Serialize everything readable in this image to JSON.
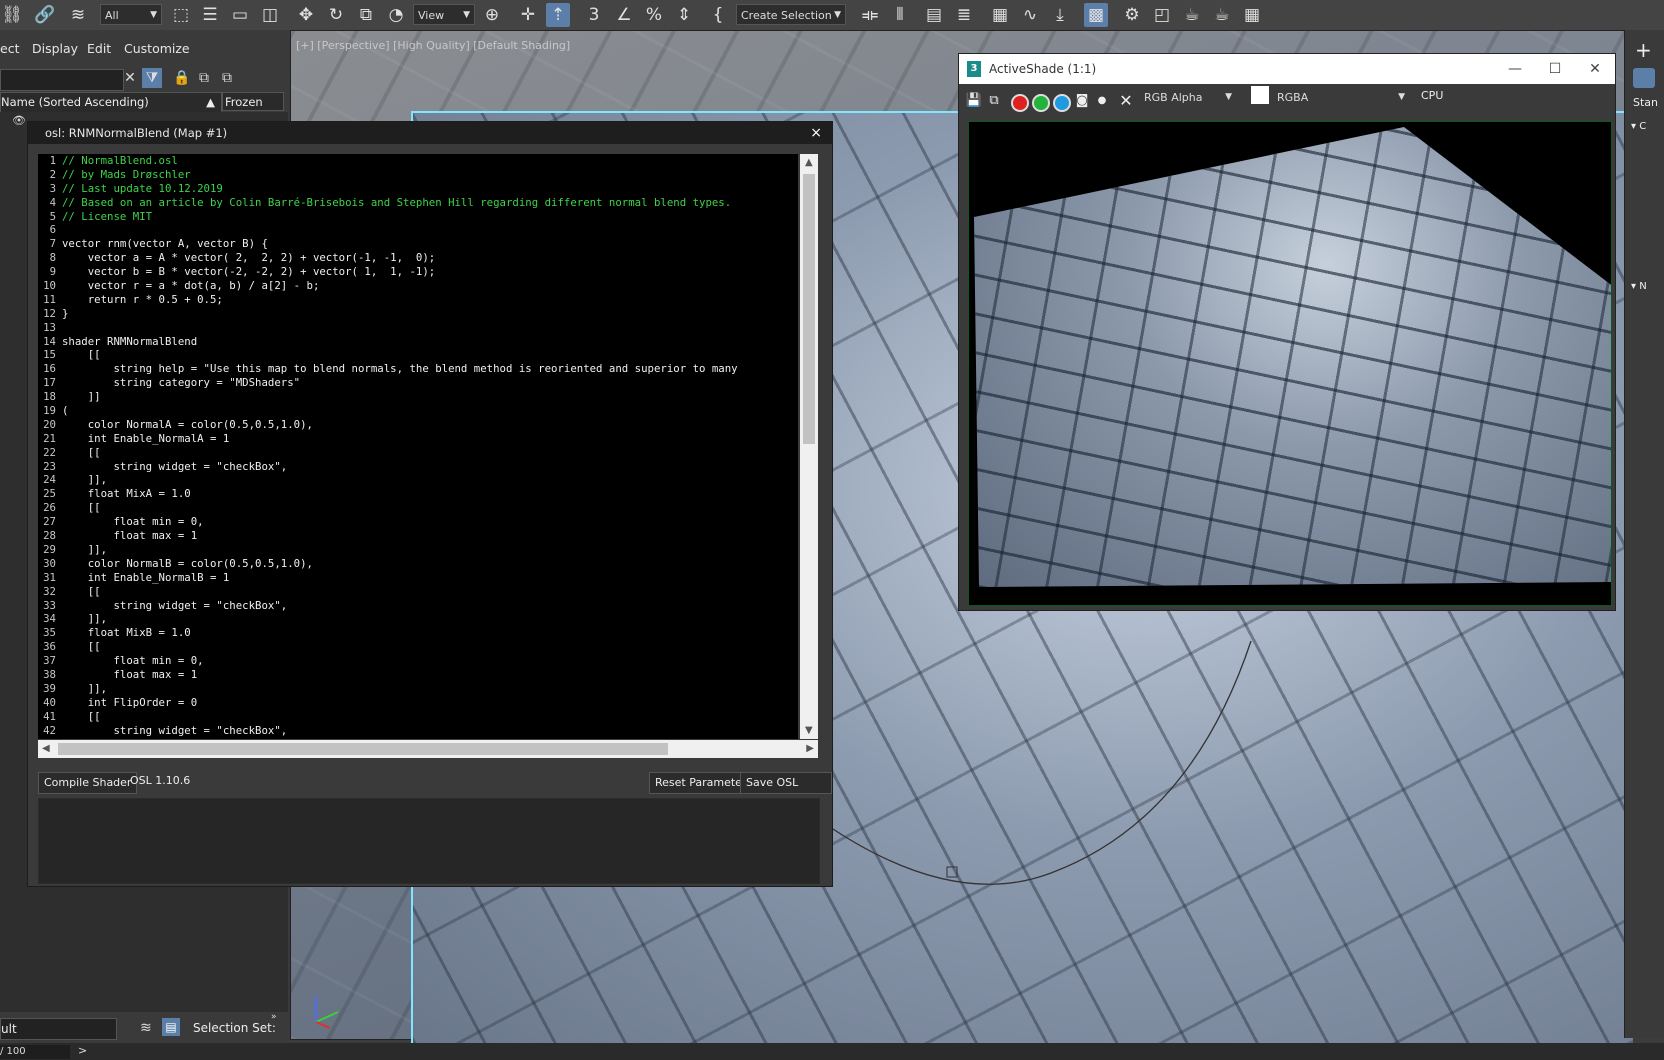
{
  "toolbar": {
    "filter_dropdown": "All",
    "view_dropdown": "View",
    "selection_set": "Create Selection Se"
  },
  "explorer": {
    "menu": [
      "ect",
      "Display",
      "Edit",
      "Customize"
    ],
    "column_name": "Name (Sorted Ascending)",
    "column_frozen": "Frozen"
  },
  "viewport": {
    "label": "[+] [Perspective] [High Quality] [Default Shading]"
  },
  "osl_editor": {
    "title": "osl: RNMNormalBlend (Map #1)",
    "close": "×",
    "code": [
      {
        "n": "1",
        "t": "// NormalBlend.osl",
        "c": true
      },
      {
        "n": "2",
        "t": "// by Mads Drøschler",
        "c": true
      },
      {
        "n": "3",
        "t": "// Last update 10.12.2019",
        "c": true
      },
      {
        "n": "4",
        "t": "// Based on an article by Colin Barré-Brisebois and Stephen Hill regarding different normal blend types.",
        "c": true
      },
      {
        "n": "5",
        "t": "// License MIT",
        "c": true
      },
      {
        "n": "6",
        "t": "",
        "c": false
      },
      {
        "n": "7",
        "t": "vector rnm(vector A, vector B) {",
        "c": false
      },
      {
        "n": "8",
        "t": "    vector a = A * vector( 2,  2, 2) + vector(-1, -1,  0);",
        "c": false
      },
      {
        "n": "9",
        "t": "    vector b = B * vector(-2, -2, 2) + vector( 1,  1, -1);",
        "c": false
      },
      {
        "n": "10",
        "t": "    vector r = a * dot(a, b) / a[2] - b;",
        "c": false
      },
      {
        "n": "11",
        "t": "    return r * 0.5 + 0.5;",
        "c": false
      },
      {
        "n": "12",
        "t": "}",
        "c": false
      },
      {
        "n": "13",
        "t": "",
        "c": false
      },
      {
        "n": "14",
        "t": "shader RNMNormalBlend",
        "c": false
      },
      {
        "n": "15",
        "t": "    [[",
        "c": false
      },
      {
        "n": "16",
        "t": "        string help = \"Use this map to blend normals, the blend method is reoriented and superior to many",
        "c": false
      },
      {
        "n": "17",
        "t": "        string category = \"MDShaders\"",
        "c": false
      },
      {
        "n": "18",
        "t": "    ]]",
        "c": false
      },
      {
        "n": "19",
        "t": "(",
        "c": false
      },
      {
        "n": "20",
        "t": "    color NormalA = color(0.5,0.5,1.0),",
        "c": false
      },
      {
        "n": "21",
        "t": "    int Enable_NormalA = 1",
        "c": false
      },
      {
        "n": "22",
        "t": "    [[",
        "c": false
      },
      {
        "n": "23",
        "t": "        string widget = \"checkBox\",",
        "c": false
      },
      {
        "n": "24",
        "t": "    ]],",
        "c": false
      },
      {
        "n": "25",
        "t": "    float MixA = 1.0",
        "c": false
      },
      {
        "n": "26",
        "t": "    [[",
        "c": false
      },
      {
        "n": "27",
        "t": "        float min = 0,",
        "c": false
      },
      {
        "n": "28",
        "t": "        float max = 1",
        "c": false
      },
      {
        "n": "29",
        "t": "    ]],",
        "c": false
      },
      {
        "n": "30",
        "t": "    color NormalB = color(0.5,0.5,1.0),",
        "c": false
      },
      {
        "n": "31",
        "t": "    int Enable_NormalB = 1",
        "c": false
      },
      {
        "n": "32",
        "t": "    [[",
        "c": false
      },
      {
        "n": "33",
        "t": "        string widget = \"checkBox\",",
        "c": false
      },
      {
        "n": "34",
        "t": "    ]],",
        "c": false
      },
      {
        "n": "35",
        "t": "    float MixB = 1.0",
        "c": false
      },
      {
        "n": "36",
        "t": "    [[",
        "c": false
      },
      {
        "n": "37",
        "t": "        float min = 0,",
        "c": false
      },
      {
        "n": "38",
        "t": "        float max = 1",
        "c": false
      },
      {
        "n": "39",
        "t": "    ]],",
        "c": false
      },
      {
        "n": "40",
        "t": "    int FlipOrder = 0",
        "c": false
      },
      {
        "n": "41",
        "t": "    [[",
        "c": false
      },
      {
        "n": "42",
        "t": "        string widget = \"checkBox\",",
        "c": false
      }
    ],
    "compile_button": "Compile Shader",
    "version": "OSL 1.10.6",
    "reset_button": "Reset Parameters",
    "save_button": "Save OSL file...."
  },
  "activeshade": {
    "title": "ActiveShade (1:1)",
    "logo": "3",
    "channel_dropdown": "RGB Alpha",
    "display_dropdown": "RGBA",
    "renderer": "CPU",
    "colors": {
      "red": "#e02020",
      "green": "#22b33a",
      "blue": "#1e9be0"
    }
  },
  "command_panel": {
    "tab": "Stan",
    "rollout_1": "C",
    "rollout_2": "N"
  },
  "bottom": {
    "layer": "ult",
    "selection_set_label": "Selection Set:",
    "frame": "/ 100",
    "expand": ">"
  }
}
